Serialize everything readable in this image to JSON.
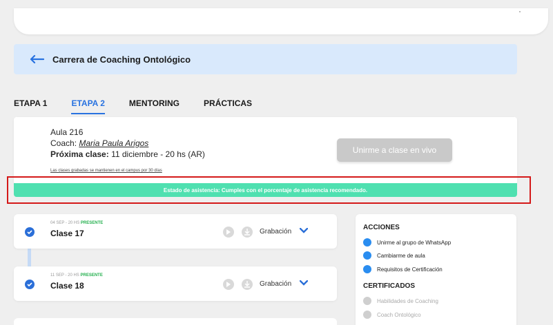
{
  "course": {
    "title": "Carrera de Coaching Ontológico"
  },
  "tabs": [
    {
      "label": "ETAPA 1"
    },
    {
      "label": "ETAPA 2"
    },
    {
      "label": "MENTORING"
    },
    {
      "label": "PRÁCTICAS"
    }
  ],
  "active_tab": "ETAPA 2",
  "aula": {
    "name": "Aula 216",
    "coach_label": "Coach:",
    "coach_name": "Maria Paula Arigos",
    "next_class_label": "Próxima clase:",
    "next_class_value": "11 diciembre - 20 hs (AR)",
    "recorded_note": "Las clases grabadas se mantienen en el campus por 30 días",
    "live_button_label": "Unirme a clase en vivo"
  },
  "attendance": {
    "message": "Estado de asistencia: Cumples con el porcentaje de asistencia recomendado."
  },
  "classes": [
    {
      "date": "04 SEP - 20 HS",
      "status": "PRESENTE",
      "title": "Clase 17",
      "recording_label": "Grabación"
    },
    {
      "date": "11 SEP - 20 HS",
      "status": "PRESENTE",
      "title": "Clase 18",
      "recording_label": "Grabación"
    }
  ],
  "actions": {
    "heading": "ACCIONES",
    "items": [
      {
        "label": "Unirme al grupo de WhatsApp",
        "icon": "whatsapp-icon"
      },
      {
        "label": "Cambiarme de aula",
        "icon": "calendar-icon"
      },
      {
        "label": "Requisitos de Certificación",
        "icon": "graduation-cap-icon"
      }
    ]
  },
  "certificates": {
    "heading": "CERTIFICADOS",
    "items": [
      {
        "label": "Habilidades de Coaching",
        "icon": "certificate-icon"
      },
      {
        "label": "Coach Ontológico",
        "icon": "certificate-icon"
      }
    ]
  },
  "colors": {
    "accent": "#2872e0",
    "attendance_bar": "#4fe0b0",
    "highlight": "#d41818",
    "present": "#24b04e"
  }
}
